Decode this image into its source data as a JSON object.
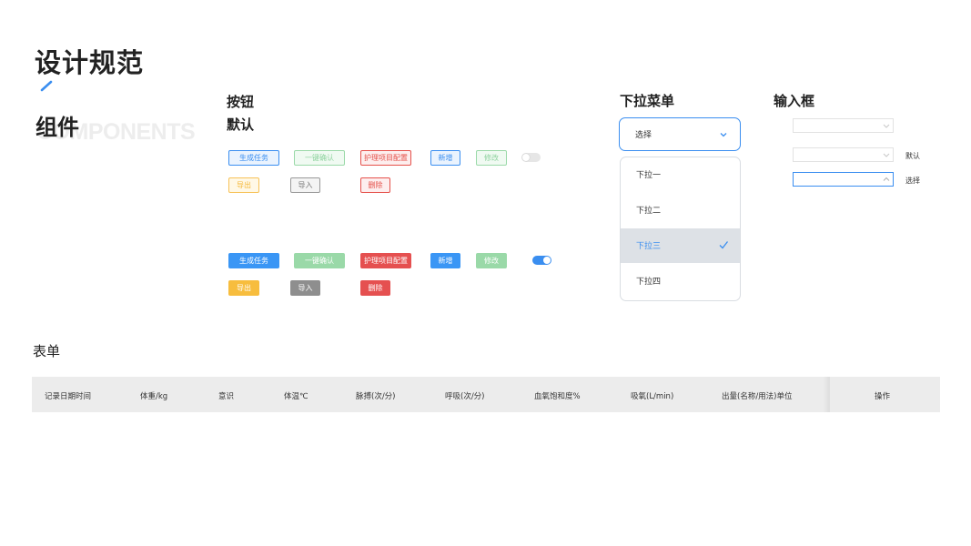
{
  "page": {
    "title": "设计规范",
    "section_title": "组件",
    "section_title_en": "COMPONENTS",
    "accent_color": "#3a8ef0"
  },
  "buttons": {
    "heading": "按钮",
    "subheading": "默认",
    "outlined_row1": [
      "生成任务",
      "一键确认",
      "护理项目配置",
      "新增",
      "修改"
    ],
    "outlined_row2": [
      "导出",
      "导入",
      "删除"
    ],
    "filled_row1": [
      "生成任务",
      "一键确认",
      "护理项目配置",
      "新增",
      "修改"
    ],
    "filled_row2": [
      "导出",
      "导入",
      "删除"
    ],
    "toggle_off_state": "off",
    "toggle_on_state": "on"
  },
  "dropdown": {
    "heading": "下拉菜单",
    "value": "选择",
    "options": [
      "下拉一",
      "下拉二",
      "下拉三",
      "下拉四"
    ],
    "selected_index": 2
  },
  "input": {
    "heading": "输入框",
    "label_default": "默认",
    "label_select": "选择"
  },
  "form": {
    "heading": "表单",
    "columns": [
      "记录日期时间",
      "体重/kg",
      "意识",
      "体温℃",
      "脉搏(次/分)",
      "呼吸(次/分)",
      "血氧饱和度%",
      "吸氧(L/min)",
      "出量(名称/用法)单位",
      "操作"
    ]
  }
}
